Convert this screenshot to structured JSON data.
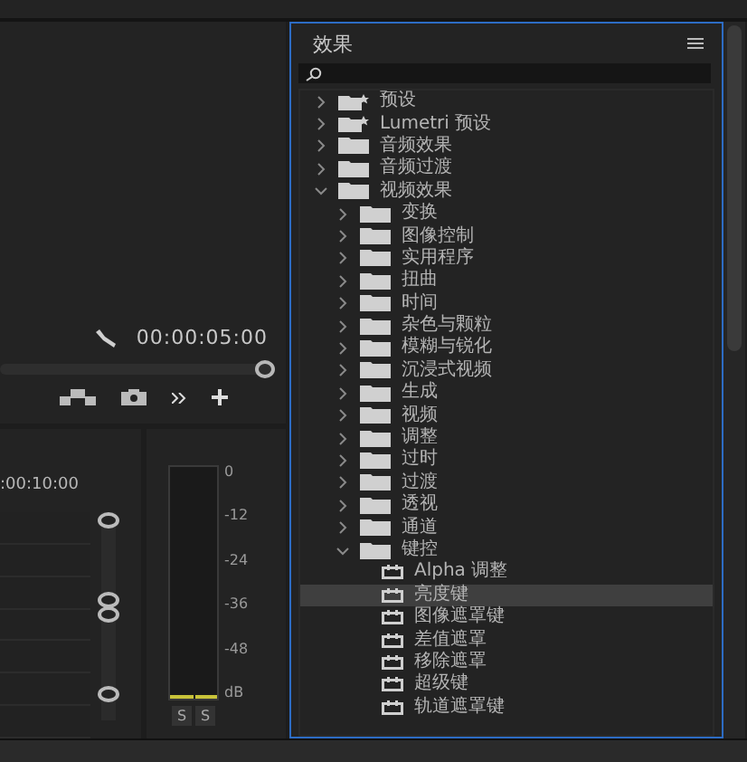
{
  "monitor": {
    "timecode": "00:00:05:00",
    "playhead": {
      "level": 1
    }
  },
  "timeline": {
    "timecode": ":00:10:00"
  },
  "audio_meter": {
    "scale": [
      "0",
      "-12",
      "-24",
      "-36",
      "-48",
      "dB"
    ],
    "solo_buttons": [
      "S",
      "S"
    ]
  },
  "effects_panel": {
    "title": "效果",
    "tree": [
      {
        "label": "预设",
        "kind": "preset",
        "expanded": false,
        "selected": false
      },
      {
        "label": "Lumetri 预设",
        "kind": "preset",
        "expanded": false,
        "selected": false
      },
      {
        "label": "音频效果",
        "kind": "folder",
        "expanded": false,
        "selected": false
      },
      {
        "label": "音频过渡",
        "kind": "folder",
        "expanded": false,
        "selected": false
      },
      {
        "label": "视频效果",
        "kind": "folder",
        "expanded": true,
        "selected": false,
        "children": [
          {
            "label": "变换",
            "kind": "folder",
            "expanded": false,
            "selected": false
          },
          {
            "label": "图像控制",
            "kind": "folder",
            "expanded": false,
            "selected": false
          },
          {
            "label": "实用程序",
            "kind": "folder",
            "expanded": false,
            "selected": false
          },
          {
            "label": "扭曲",
            "kind": "folder",
            "expanded": false,
            "selected": false
          },
          {
            "label": "时间",
            "kind": "folder",
            "expanded": false,
            "selected": false
          },
          {
            "label": "杂色与颗粒",
            "kind": "folder",
            "expanded": false,
            "selected": false
          },
          {
            "label": "模糊与锐化",
            "kind": "folder",
            "expanded": false,
            "selected": false
          },
          {
            "label": "沉浸式视频",
            "kind": "folder",
            "expanded": false,
            "selected": false
          },
          {
            "label": "生成",
            "kind": "folder",
            "expanded": false,
            "selected": false
          },
          {
            "label": "视频",
            "kind": "folder",
            "expanded": false,
            "selected": false
          },
          {
            "label": "调整",
            "kind": "folder",
            "expanded": false,
            "selected": false
          },
          {
            "label": "过时",
            "kind": "folder",
            "expanded": false,
            "selected": false
          },
          {
            "label": "过渡",
            "kind": "folder",
            "expanded": false,
            "selected": false
          },
          {
            "label": "透视",
            "kind": "folder",
            "expanded": false,
            "selected": false
          },
          {
            "label": "通道",
            "kind": "folder",
            "expanded": false,
            "selected": false
          },
          {
            "label": "键控",
            "kind": "folder",
            "expanded": true,
            "selected": false,
            "children": [
              {
                "label": "Alpha 调整",
                "kind": "effect",
                "selected": false
              },
              {
                "label": "亮度键",
                "kind": "effect",
                "selected": true
              },
              {
                "label": "图像遮罩键",
                "kind": "effect",
                "selected": false
              },
              {
                "label": "差值遮罩",
                "kind": "effect",
                "selected": false
              },
              {
                "label": "移除遮罩",
                "kind": "effect",
                "selected": false
              },
              {
                "label": "超级键",
                "kind": "effect",
                "selected": false
              },
              {
                "label": "轨道遮罩键",
                "kind": "effect",
                "selected": false
              }
            ]
          }
        ]
      }
    ]
  }
}
